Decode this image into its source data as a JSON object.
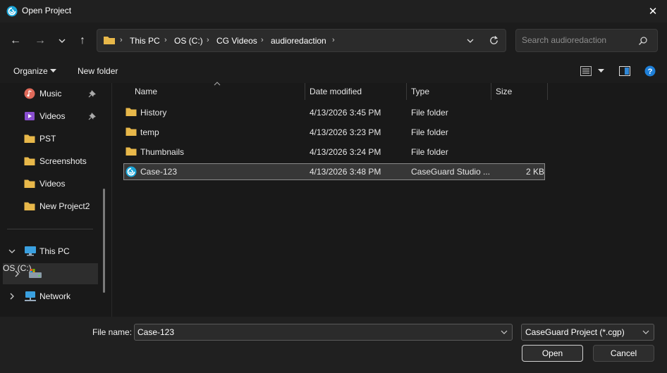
{
  "window": {
    "title": "Open Project",
    "close_glyph": "✕"
  },
  "nav": {
    "back_glyph": "←",
    "forward_glyph": "→",
    "recent_glyph": "⌄",
    "up_glyph": "↑"
  },
  "breadcrumb": {
    "items": [
      "This PC",
      "OS (C:)",
      "CG Videos",
      "audioredaction"
    ],
    "separator": "›"
  },
  "search": {
    "placeholder": "Search audioredaction"
  },
  "toolbar": {
    "organize_label": "Organize",
    "new_folder_label": "New folder"
  },
  "sidebar": {
    "quick_access": [
      {
        "label": "Music",
        "icon": "music-icon",
        "pinned": true
      },
      {
        "label": "Videos",
        "icon": "videos-icon",
        "pinned": true
      },
      {
        "label": "PST",
        "icon": "folder-icon"
      },
      {
        "label": "Screenshots",
        "icon": "folder-icon"
      },
      {
        "label": "Videos",
        "icon": "folder-icon"
      },
      {
        "label": "New Project2",
        "icon": "folder-icon"
      }
    ],
    "tree": [
      {
        "label": "This PC",
        "icon": "computer-icon",
        "expanded": true
      },
      {
        "label": "OS (C:)",
        "icon": "drive-icon",
        "selected": true
      },
      {
        "label": "Network",
        "icon": "network-icon"
      }
    ]
  },
  "columns": {
    "name": "Name",
    "date": "Date modified",
    "type": "Type",
    "size": "Size"
  },
  "files": [
    {
      "name": "History",
      "date": "4/13/2026 3:45 PM",
      "type": "File folder",
      "size": "",
      "icon": "folder-icon"
    },
    {
      "name": "temp",
      "date": "4/13/2026 3:23 PM",
      "type": "File folder",
      "size": "",
      "icon": "folder-icon"
    },
    {
      "name": "Thumbnails",
      "date": "4/13/2026 3:24 PM",
      "type": "File folder",
      "size": "",
      "icon": "folder-icon"
    },
    {
      "name": "Case-123",
      "date": "4/13/2026 3:48 PM",
      "type": "CaseGuard Studio ...",
      "size": "2 KB",
      "icon": "caseguard-icon",
      "selected": true
    }
  ],
  "bottom": {
    "file_name_label": "File name:",
    "file_name_value": "Case-123",
    "file_type_value": "CaseGuard Project (*.cgp)",
    "open_label": "Open",
    "cancel_label": "Cancel"
  },
  "colors": {
    "background": "#191919",
    "folder": "#e8b84a",
    "accent": "#1a9fd8",
    "help": "#1e7fd8"
  }
}
